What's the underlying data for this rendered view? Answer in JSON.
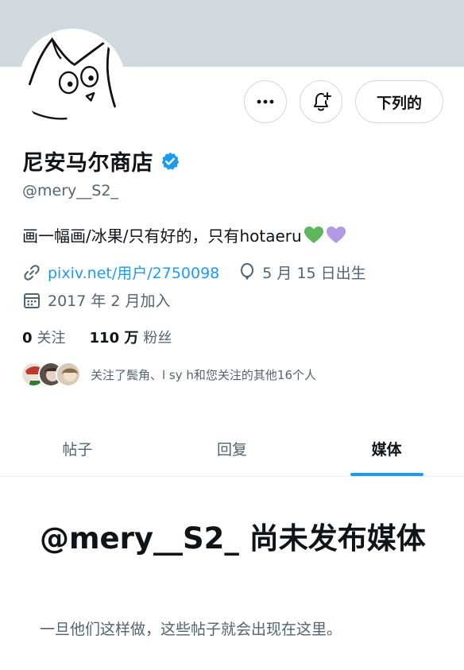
{
  "header": {
    "banner_color": "#cfd9de",
    "more_icon": "more-icon",
    "notify_icon": "bell-plus-icon",
    "follow_label": "下列的"
  },
  "profile": {
    "name": "尼安马尔商店",
    "verified": true,
    "handle": "@mery__S2_",
    "bio_text": "画一幅画/冰果/只有好的，只有hotaeru",
    "bio_hearts": [
      "green-heart",
      "purple-heart"
    ],
    "link": "pixiv.net/用户/2750098",
    "birthday": "5 月 15 日出生",
    "joined": "2017 年 2 月加入"
  },
  "stats": {
    "following_count": "0",
    "following_label": "关注",
    "followers_count": "110 万",
    "followers_label": "粉丝"
  },
  "followed_by": {
    "text": "关注了鬓角、l sy h和您关注的其他16个人"
  },
  "tabs": [
    {
      "label": "帖子",
      "active": false
    },
    {
      "label": "回复",
      "active": false
    },
    {
      "label": "媒体",
      "active": true
    }
  ],
  "empty_state": {
    "title": "@mery__S2_ 尚未发布媒体",
    "subtitle": "一旦他们这样做，这些帖子就会出现在这里。"
  },
  "colors": {
    "accent": "#1d9bf0",
    "text": "#0f1419",
    "muted": "#536471"
  }
}
